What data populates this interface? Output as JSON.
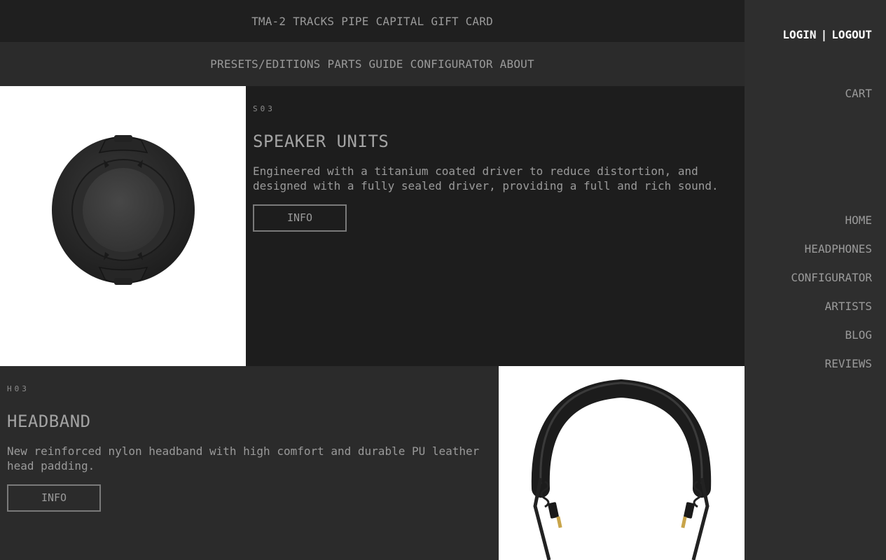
{
  "top_nav": [
    "TMA-2",
    "TRACKS",
    "PIPE",
    "CAPITAL",
    "GIFT CARD"
  ],
  "sub_nav": [
    "PRESETS/EDITIONS",
    "PARTS GUIDE",
    "CONFIGURATOR",
    "ABOUT"
  ],
  "products": [
    {
      "code": "S03",
      "title": "SPEAKER UNITS",
      "description": "Engineered with a titanium coated driver to reduce distortion, and designed with a fully sealed driver, providing a full and rich sound.",
      "button": "INFO",
      "image_icon": "speaker-unit-image"
    },
    {
      "code": "H03",
      "title": "HEADBAND",
      "description": "New reinforced nylon headband with high comfort and durable PU leather head padding.",
      "button": "INFO",
      "image_icon": "headband-image"
    }
  ],
  "sidebar": {
    "login": "LOGIN",
    "separator": "|",
    "logout": "LOGOUT",
    "cart": "CART",
    "nav": [
      "HOME",
      "HEADPHONES",
      "CONFIGURATOR",
      "ARTISTS",
      "BLOG",
      "REVIEWS"
    ]
  },
  "colors": {
    "background_dark": "#1d1d1d",
    "background_mid": "#2b2b2b",
    "sidebar": "#2e2e2e",
    "text": "#9a9a9a",
    "auth_text": "#ffffff"
  }
}
